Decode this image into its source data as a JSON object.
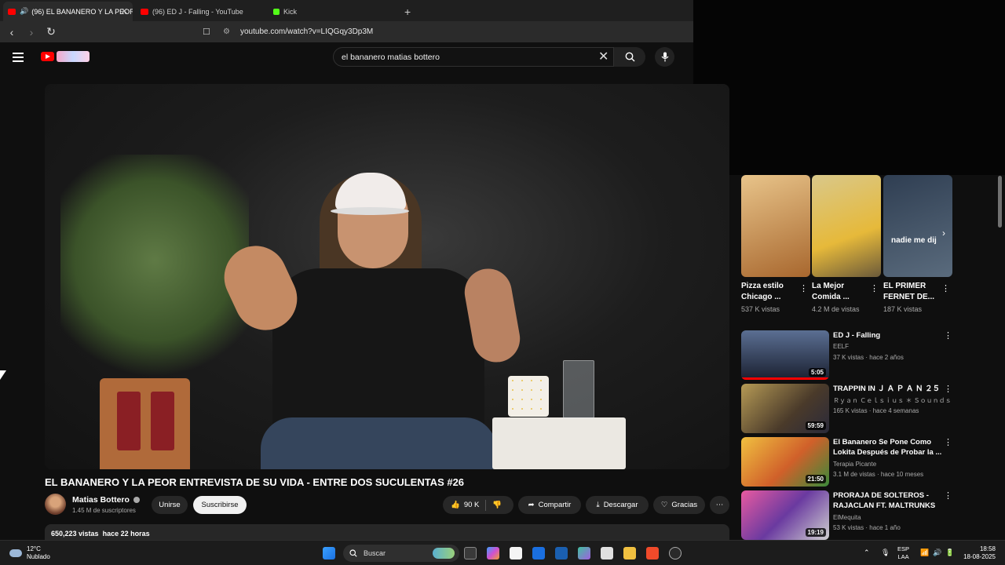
{
  "browser": {
    "tabs": [
      {
        "label": "(96) EL BANANERO Y LA PEOR",
        "active": true,
        "favicon": "youtube-icon",
        "audio": true
      },
      {
        "label": "(96) ED J - Falling - YouTube",
        "active": false,
        "favicon": "youtube-icon"
      },
      {
        "label": "Kick",
        "active": false,
        "favicon": "kick-icon"
      }
    ],
    "url": "youtube.com/watch?v=LIQGqy3Dp3M"
  },
  "youtube": {
    "search_value": "el bananero matias bottero"
  },
  "video": {
    "title": "EL BANANERO Y LA PEOR ENTREVISTA DE SU VIDA - ENTRE DOS SUCULENTAS #26",
    "channel": "Matias Bottero",
    "subscribers": "1.45 M de suscriptores",
    "join_label": "Unirse",
    "subscribe_label": "Suscribirse",
    "likes": "90 K",
    "share_label": "Compartir",
    "download_label": "Descargar",
    "thanks_label": "Gracias",
    "views": "650,223 vistas",
    "age": "hace 22 horas"
  },
  "shorts": [
    {
      "title": "Pizza estilo Chicago ...",
      "views": "537 K vistas",
      "color": "#c99055"
    },
    {
      "title": "La Mejor Comida ...",
      "views": "4.2 M de vistas",
      "color": "#b59a55"
    },
    {
      "title": "EL PRIMER FERNET DE...",
      "views": "187 K vistas",
      "overlay": "nadie me dij",
      "color": "#3a4a5c"
    }
  ],
  "recommended": [
    {
      "title": "ED J - Falling",
      "channel": "EELF",
      "meta": "37 K vistas · hace 2 años",
      "duration": "5:05",
      "progress": 1.0,
      "color": "#3d4a63"
    },
    {
      "title": "TRAPPIN IN Ｊ Ａ Ｐ Ａ Ｎ ２５",
      "channel": "Ｒｙａｎ Ｃｅｌｓｉｕｓ ＊ Ｓｏｕｎｄｓ",
      "meta": "165 K vistas · hace 4 semanas",
      "duration": "59:59",
      "progress": 0.0,
      "color": "#6a5a3a"
    },
    {
      "title": "El Bananero Se Pone Como Lokita Después de Probar la ...",
      "channel": "Terapia Picante",
      "meta": "3.1 M de vistas · hace 10 meses",
      "duration": "21:50",
      "progress": 0.0,
      "color": "#c9a23a"
    },
    {
      "title": "PRORAJA DE SOLTEROS - RAJACLAN FT. MALTRUNKS",
      "channel": "ElMequita",
      "meta": "53 K vistas · hace 1 año",
      "duration": "19:19",
      "progress": 0.0,
      "color": "#8a3a6a"
    }
  ],
  "taskbar": {
    "weather_temp": "12°C",
    "weather_desc": "Nublado",
    "search_label": "Buscar",
    "lang1": "ESP",
    "lang2": "LAA",
    "time": "18:58",
    "date": "18-08-2025"
  }
}
